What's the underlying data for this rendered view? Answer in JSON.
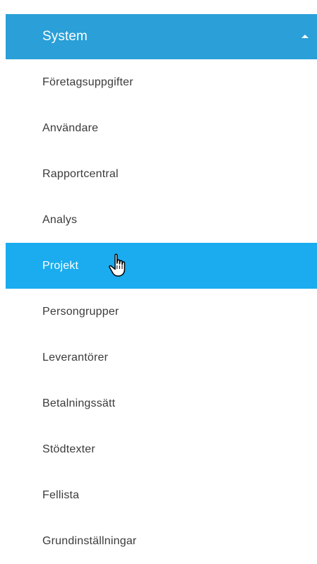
{
  "menu": {
    "header": {
      "label": "System",
      "icon": "caret-up-icon",
      "color": "#2a9fd8"
    },
    "active_color": "#1aacef",
    "items": [
      {
        "label": "Företagsuppgifter",
        "active": false
      },
      {
        "label": "Användare",
        "active": false
      },
      {
        "label": "Rapportcentral",
        "active": false
      },
      {
        "label": "Analys",
        "active": false
      },
      {
        "label": "Projekt",
        "active": true
      },
      {
        "label": "Persongrupper",
        "active": false
      },
      {
        "label": "Leverantörer",
        "active": false
      },
      {
        "label": "Betalningssätt",
        "active": false
      },
      {
        "label": "Stödtexter",
        "active": false
      },
      {
        "label": "Fellista",
        "active": false
      },
      {
        "label": "Grundinställningar",
        "active": false
      }
    ]
  },
  "cursor": {
    "icon": "hand-pointer-icon"
  }
}
